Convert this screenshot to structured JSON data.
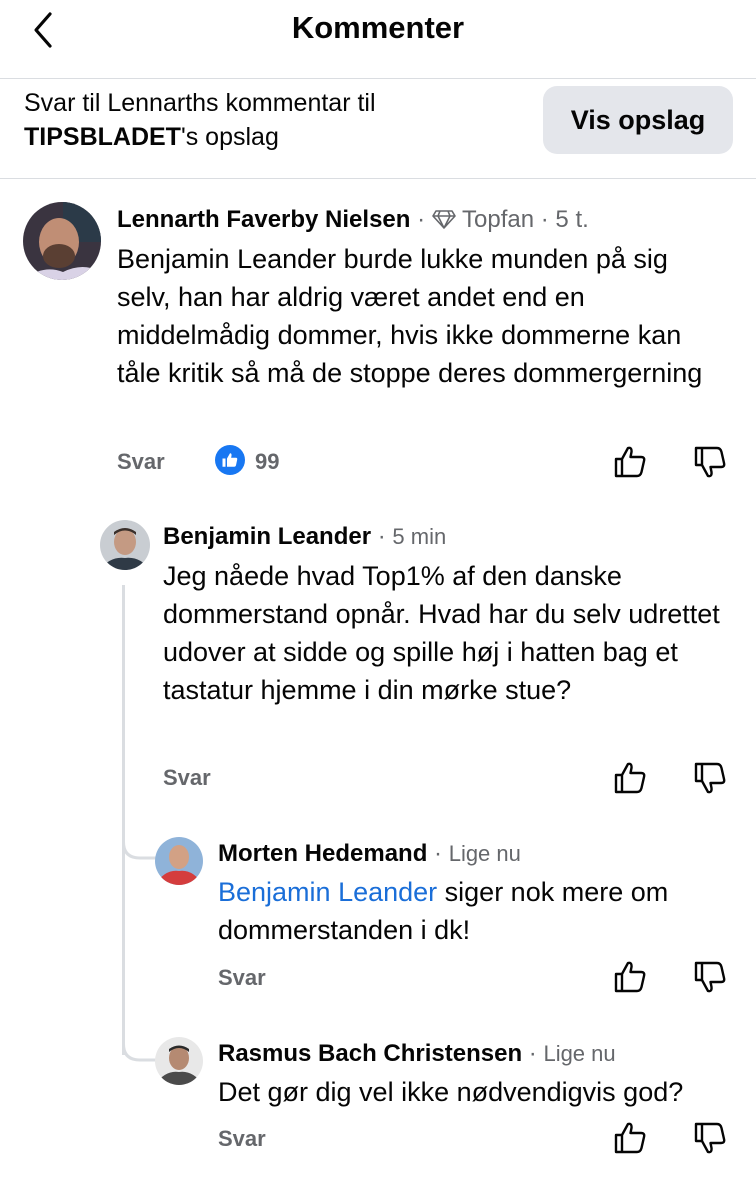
{
  "header": {
    "title": "Kommenter",
    "reply_prefix": "Svar til Lennarths kommentar til",
    "reply_page": "TIPSBLADET",
    "reply_suffix": "'s opslag",
    "view_post_button": "Vis opslag"
  },
  "comments": [
    {
      "author": "Lennarth Faverby Nielsen",
      "badge": "Topfan",
      "time": "5 t.",
      "text": "Benjamin Leander burde lukke munden på sig selv, han har aldrig været andet end en middelmådig dommer, hvis ikke dommerne kan tåle kritik så må de stoppe deres dommergerning",
      "reply_label": "Svar",
      "like_count": "99"
    },
    {
      "author": "Benjamin Leander",
      "time": "5 min",
      "text": "Jeg nåede hvad Top1% af den danske dommerstand opnår. Hvad har du selv udrettet udover at sidde og spille høj i hatten bag et tastatur hjemme i din mørke stue?",
      "reply_label": "Svar"
    },
    {
      "author": "Morten Hedemand",
      "time": "Lige nu",
      "mention": "Benjamin Leander",
      "text": " siger nok mere om dommerstanden i dk!",
      "reply_label": "Svar"
    },
    {
      "author": "Rasmus Bach Christensen",
      "time": "Lige nu",
      "text": "Det gør dig vel ikke nødvendigvis god?",
      "reply_label": "Svar"
    }
  ],
  "colors": {
    "link": "#1a6ed8",
    "meta": "#65676b",
    "like_badge": "#1877f2",
    "button_bg": "#e4e6eb"
  }
}
